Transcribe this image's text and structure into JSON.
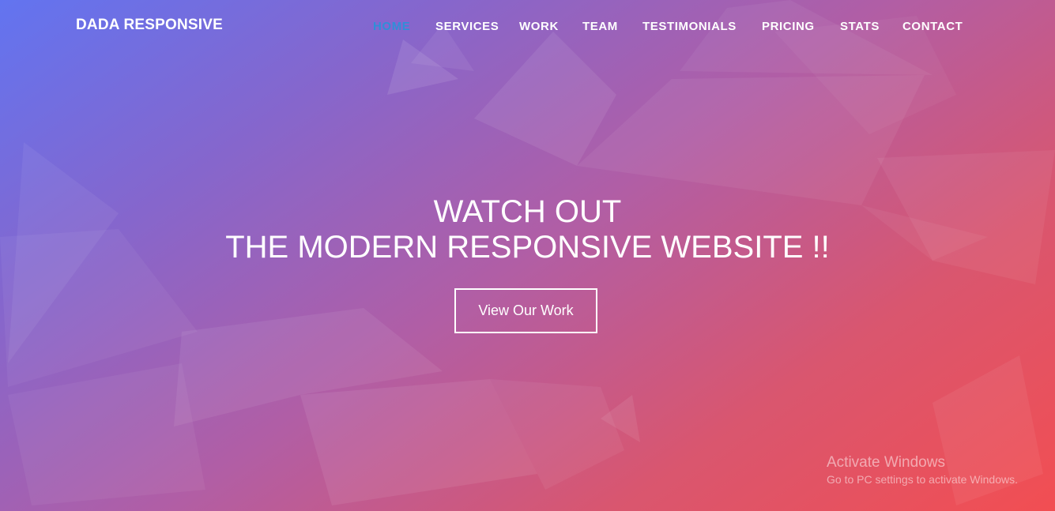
{
  "brand": {
    "name": "DADA RESPONSIVE"
  },
  "nav": {
    "items": [
      {
        "label": "HOME",
        "active": true
      },
      {
        "label": "SERVICES",
        "active": false
      },
      {
        "label": "WORK",
        "active": false
      },
      {
        "label": "TEAM",
        "active": false
      },
      {
        "label": "TESTIMONIALS",
        "active": false
      },
      {
        "label": "PRICING",
        "active": false
      },
      {
        "label": "STATS",
        "active": false
      },
      {
        "label": "CONTACT",
        "active": false
      }
    ]
  },
  "hero": {
    "line1": "WATCH OUT",
    "line2": "THE MODERN RESPONSIVE WEBSITE !!",
    "cta_label": "View Our Work"
  },
  "watermark": {
    "title": "Activate Windows",
    "subtitle": "Go to PC settings to activate Windows."
  },
  "colors": {
    "gradient_start": "#6274f0",
    "gradient_end": "#f24e52",
    "active_nav": "#2f8fd8",
    "text": "#ffffff"
  }
}
